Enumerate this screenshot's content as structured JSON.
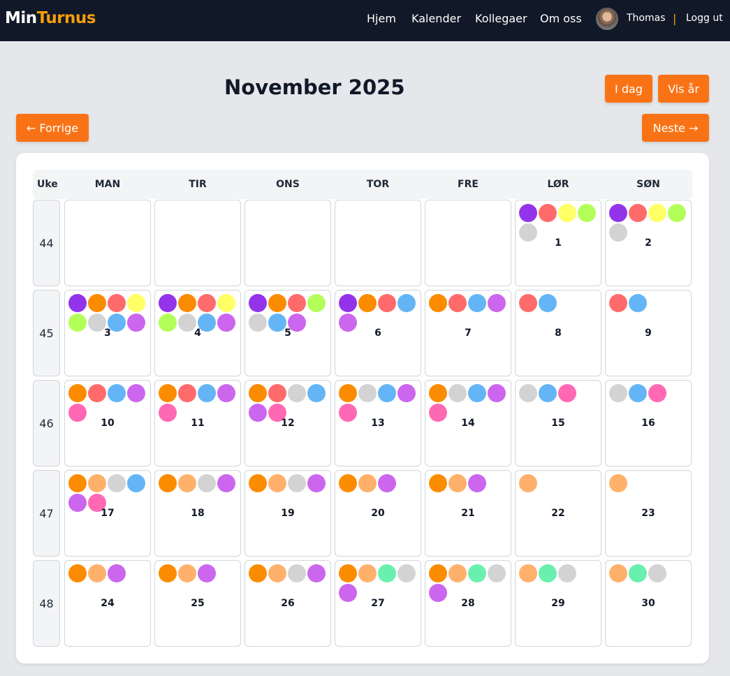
{
  "navbar": {
    "logo_part1": "Min",
    "logo_part2": "Turnus",
    "links": [
      "Hjem",
      "Kalender",
      "Kollegaer",
      "Om oss"
    ],
    "user_name": "Thomas",
    "separator": "|",
    "logout_label": "Logg ut"
  },
  "calendar": {
    "month_title": "November 2025",
    "today_label": "I dag",
    "year_label": "Vis år",
    "prev_label": "← Forrige",
    "next_label": "Neste →",
    "week_header": "Uke",
    "day_headers": [
      "MAN",
      "TIR",
      "ONS",
      "TOR",
      "FRE",
      "LØR",
      "SØN"
    ]
  },
  "colors": {
    "purple": "#9333ea",
    "orange": "#fb8c00",
    "red": "#ff6b6b",
    "yellow": "#ffff66",
    "lime": "#b2ff59",
    "gray": "#d3d3d3",
    "blue": "#64b5f6",
    "violet": "#cc66ee",
    "pink": "#ff69b4",
    "peach": "#ffb16c",
    "mint": "#69f0ae"
  },
  "weeks": [
    {
      "number": "44",
      "days": [
        {
          "date": "",
          "dots": []
        },
        {
          "date": "",
          "dots": []
        },
        {
          "date": "",
          "dots": []
        },
        {
          "date": "",
          "dots": []
        },
        {
          "date": "",
          "dots": []
        },
        {
          "date": "1",
          "dots": [
            "purple",
            "red",
            "yellow",
            "lime",
            "gray"
          ]
        },
        {
          "date": "2",
          "dots": [
            "purple",
            "red",
            "yellow",
            "lime",
            "gray"
          ]
        }
      ]
    },
    {
      "number": "45",
      "days": [
        {
          "date": "3",
          "dots": [
            "purple",
            "orange",
            "red",
            "yellow",
            "lime",
            "gray",
            "blue",
            "violet"
          ]
        },
        {
          "date": "4",
          "dots": [
            "purple",
            "orange",
            "red",
            "yellow",
            "lime",
            "gray",
            "blue",
            "violet"
          ]
        },
        {
          "date": "5",
          "dots": [
            "purple",
            "orange",
            "red",
            "lime",
            "gray",
            "blue",
            "violet"
          ]
        },
        {
          "date": "6",
          "dots": [
            "purple",
            "orange",
            "red",
            "blue",
            "violet"
          ]
        },
        {
          "date": "7",
          "dots": [
            "orange",
            "red",
            "blue",
            "violet"
          ]
        },
        {
          "date": "8",
          "dots": [
            "red",
            "blue"
          ]
        },
        {
          "date": "9",
          "dots": [
            "red",
            "blue"
          ]
        }
      ]
    },
    {
      "number": "46",
      "days": [
        {
          "date": "10",
          "dots": [
            "orange",
            "red",
            "blue",
            "violet",
            "pink"
          ]
        },
        {
          "date": "11",
          "dots": [
            "orange",
            "red",
            "blue",
            "violet",
            "pink"
          ]
        },
        {
          "date": "12",
          "dots": [
            "orange",
            "red",
            "gray",
            "blue",
            "violet",
            "pink"
          ]
        },
        {
          "date": "13",
          "dots": [
            "orange",
            "gray",
            "blue",
            "violet",
            "pink"
          ]
        },
        {
          "date": "14",
          "dots": [
            "orange",
            "gray",
            "blue",
            "violet",
            "pink"
          ]
        },
        {
          "date": "15",
          "dots": [
            "gray",
            "blue",
            "pink"
          ]
        },
        {
          "date": "16",
          "dots": [
            "gray",
            "blue",
            "pink"
          ]
        }
      ]
    },
    {
      "number": "47",
      "days": [
        {
          "date": "17",
          "dots": [
            "orange",
            "peach",
            "gray",
            "blue",
            "violet",
            "pink"
          ]
        },
        {
          "date": "18",
          "dots": [
            "orange",
            "peach",
            "gray",
            "violet"
          ]
        },
        {
          "date": "19",
          "dots": [
            "orange",
            "peach",
            "gray",
            "violet"
          ]
        },
        {
          "date": "20",
          "dots": [
            "orange",
            "peach",
            "violet"
          ]
        },
        {
          "date": "21",
          "dots": [
            "orange",
            "peach",
            "violet"
          ]
        },
        {
          "date": "22",
          "dots": [
            "peach"
          ]
        },
        {
          "date": "23",
          "dots": [
            "peach"
          ]
        }
      ]
    },
    {
      "number": "48",
      "days": [
        {
          "date": "24",
          "dots": [
            "orange",
            "peach",
            "violet"
          ]
        },
        {
          "date": "25",
          "dots": [
            "orange",
            "peach",
            "violet"
          ]
        },
        {
          "date": "26",
          "dots": [
            "orange",
            "peach",
            "gray",
            "violet"
          ]
        },
        {
          "date": "27",
          "dots": [
            "orange",
            "peach",
            "mint",
            "gray",
            "violet"
          ]
        },
        {
          "date": "28",
          "dots": [
            "orange",
            "peach",
            "mint",
            "gray",
            "violet"
          ]
        },
        {
          "date": "29",
          "dots": [
            "peach",
            "mint",
            "gray"
          ]
        },
        {
          "date": "30",
          "dots": [
            "peach",
            "mint",
            "gray"
          ]
        }
      ]
    }
  ]
}
